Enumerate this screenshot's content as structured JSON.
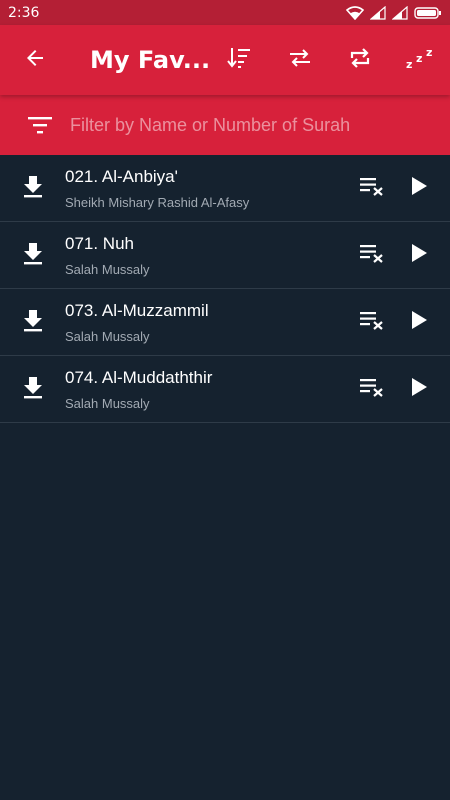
{
  "status_bar": {
    "time": "2:36",
    "icons": [
      "wifi-icon",
      "signal-icon",
      "signal-icon",
      "battery-icon"
    ]
  },
  "app_bar": {
    "title": "My Fav...",
    "back_icon": "arrow-left-icon",
    "actions": [
      "sort-icon",
      "shuffle-icon",
      "repeat-icon",
      "sleep-timer-icon"
    ]
  },
  "filter": {
    "icon": "filter-icon",
    "placeholder": "Filter by Name or Number of Surah",
    "value": ""
  },
  "favorites": [
    {
      "surah": "021. Al-Anbiya'",
      "reciter": "Sheikh Mishary Rashid Al-Afasy"
    },
    {
      "surah": "071. Nuh",
      "reciter": "Salah Mussaly"
    },
    {
      "surah": "073. Al-Muzzammil",
      "reciter": "Salah Mussaly"
    },
    {
      "surah": "074. Al-Muddaththir",
      "reciter": "Salah Mussaly"
    }
  ],
  "row_icons": {
    "download": "download-icon",
    "remove": "playlist-remove-icon",
    "play": "play-icon"
  },
  "colors": {
    "status_bar": "#b41f35",
    "app_bar": "#d7213b",
    "background": "#15222f",
    "divider": "#2e3b48",
    "subtitle": "#a2aab3"
  }
}
